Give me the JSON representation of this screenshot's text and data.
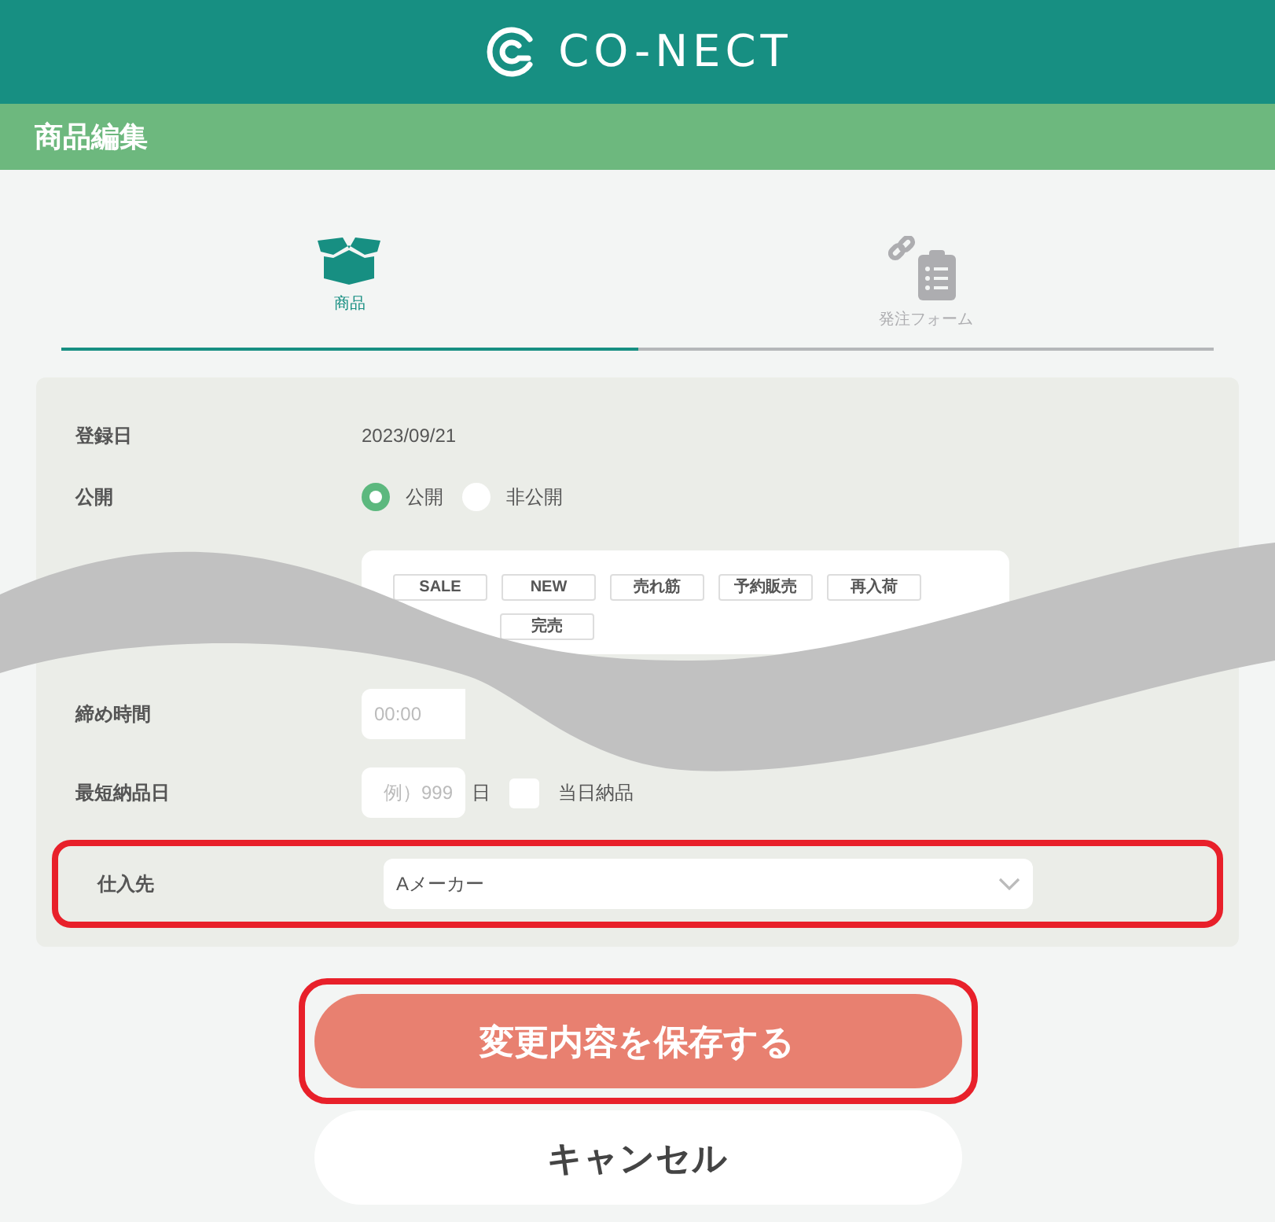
{
  "header": {
    "logo_text": "CO-NECT"
  },
  "page_title": "商品編集",
  "tabs": [
    {
      "label": "商品",
      "kind": "box",
      "selected": true
    },
    {
      "label": "発注フォーム",
      "kind": "clipboard",
      "selected": false
    }
  ],
  "form": {
    "registered": {
      "label": "登録日",
      "value": "2023/09/21"
    },
    "visibility": {
      "label": "公開",
      "options": [
        {
          "label": "公開",
          "selected": true
        },
        {
          "label": "非公開",
          "selected": false
        }
      ]
    },
    "tags": [
      [
        "SALE",
        "NEW",
        "売れ筋",
        "予約販売",
        "再入荷"
      ],
      [
        "完売"
      ]
    ],
    "deadline": {
      "label": "締め時間",
      "placeholder": "00:00"
    },
    "lead_time": {
      "label": "最短納品日",
      "placeholder": "例）999",
      "unit": "日",
      "same_day": {
        "label": "当日納品",
        "checked": false
      }
    },
    "supplier": {
      "label": "仕入先",
      "value": "Aメーカー",
      "highlighted": true
    }
  },
  "buttons": [
    {
      "label": "変更内容を保存する",
      "kind": "primary",
      "highlighted": true
    },
    {
      "label": "キャンセル",
      "kind": "secondary",
      "highlighted": false
    }
  ]
}
